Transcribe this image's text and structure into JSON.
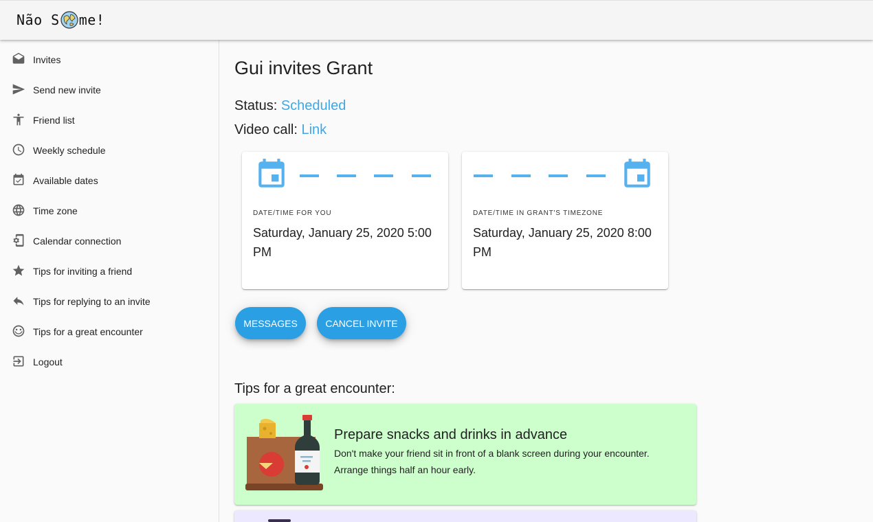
{
  "app": {
    "logo_prefix": "Não S",
    "logo_suffix": "me!"
  },
  "sidebar": {
    "items": [
      {
        "label": "Invites",
        "icon": "envelope-icon"
      },
      {
        "label": "Send new invite",
        "icon": "send-icon"
      },
      {
        "label": "Friend list",
        "icon": "accessibility-icon"
      },
      {
        "label": "Weekly schedule",
        "icon": "clock-icon"
      },
      {
        "label": "Available dates",
        "icon": "calendar-check-icon"
      },
      {
        "label": "Time zone",
        "icon": "globe-icon"
      },
      {
        "label": "Calendar connection",
        "icon": "phonelink-setup-icon"
      },
      {
        "label": "Tips for inviting a friend",
        "icon": "star-icon"
      },
      {
        "label": "Tips for replying to an invite",
        "icon": "reply-icon"
      },
      {
        "label": "Tips for a great encounter",
        "icon": "smiley-icon"
      },
      {
        "label": "Logout",
        "icon": "logout-icon"
      }
    ]
  },
  "invite": {
    "title": "Gui invites Grant",
    "status_label": "Status: ",
    "status_value": "Scheduled",
    "video_label": "Video call: ",
    "video_link": "Link"
  },
  "cards": [
    {
      "caption": "DATE/TIME FOR YOU",
      "datetime": "Saturday, January 25, 2020 5:00 PM"
    },
    {
      "caption": "DATE/TIME IN GRANT'S TIMEZONE",
      "datetime": "Saturday, January 25, 2020 8:00 PM"
    }
  ],
  "actions": {
    "messages": "MESSAGES",
    "cancel": "CANCEL INVITE"
  },
  "tips": {
    "heading": "Tips for a great encounter:",
    "items": [
      {
        "title": "Prepare snacks and drinks in advance",
        "body": "Don't make your friend sit in front of a blank screen during your encounter. Arrange things half an hour early.",
        "icon": "snacks-drinks-illustration"
      }
    ]
  },
  "colors": {
    "accent": "#2a9fe4",
    "link": "#3fa7e6",
    "calendar_icon": "#56b1ef",
    "tip_green": "#ccffcc",
    "tip_lavender": "#ece8ff"
  }
}
